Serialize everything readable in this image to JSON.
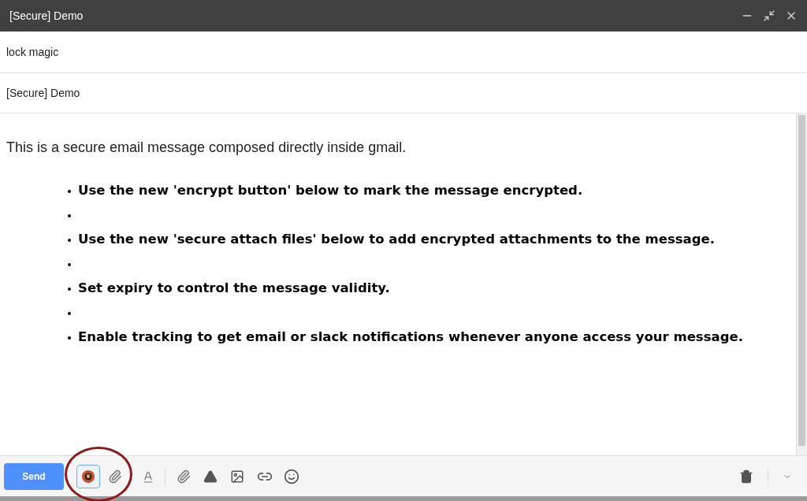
{
  "window": {
    "title": "[Secure] Demo"
  },
  "to": {
    "value": "lock magic"
  },
  "subject": {
    "value": "[Secure] Demo"
  },
  "body": {
    "intro": "This is a secure email message composed directly inside gmail.",
    "items": [
      {
        "kind": "text",
        "text": "Use the new 'encrypt button' below to mark the message encrypted."
      },
      {
        "kind": "blank"
      },
      {
        "kind": "text",
        "text": "Use the new 'secure attach files' below to add encrypted attachments to the message."
      },
      {
        "kind": "blank"
      },
      {
        "kind": "text",
        "text": "Set expiry to control the message validity."
      },
      {
        "kind": "blank"
      },
      {
        "kind": "text",
        "text": "Enable tracking to get email or slack notifications whenever anyone access your message."
      }
    ]
  },
  "toolbar": {
    "send": "Send",
    "encrypt_selected": true
  }
}
